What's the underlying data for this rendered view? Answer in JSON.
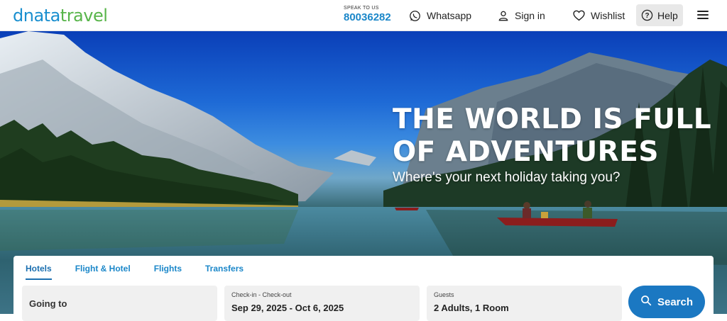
{
  "header": {
    "logo_left": "dnata",
    "logo_right": "travel",
    "speak_label": "SPEAK TO US",
    "phone": "80036282",
    "whatsapp": "Whatsapp",
    "signin": "Sign in",
    "wishlist": "Wishlist",
    "help": "Help"
  },
  "hero": {
    "headline_line1": "THE WORLD IS FULL",
    "headline_line2": "OF ADVENTURES",
    "subline": "Where's your next holiday taking you?"
  },
  "search": {
    "tabs": [
      {
        "label": "Hotels",
        "active": true
      },
      {
        "label": "Flight & Hotel",
        "active": false
      },
      {
        "label": "Flights",
        "active": false
      },
      {
        "label": "Transfers",
        "active": false
      }
    ],
    "going_to": "Going to",
    "dates_label": "Check-in - Check-out",
    "dates_value": "Sep 29, 2025 - Oct 6, 2025",
    "guests_label": "Guests",
    "guests_value": "2 Adults, 1 Room",
    "search_button": "Search"
  },
  "colors": {
    "brand_blue": "#1b87c9",
    "brand_green": "#58b54a",
    "button_blue": "#1b78c2"
  }
}
